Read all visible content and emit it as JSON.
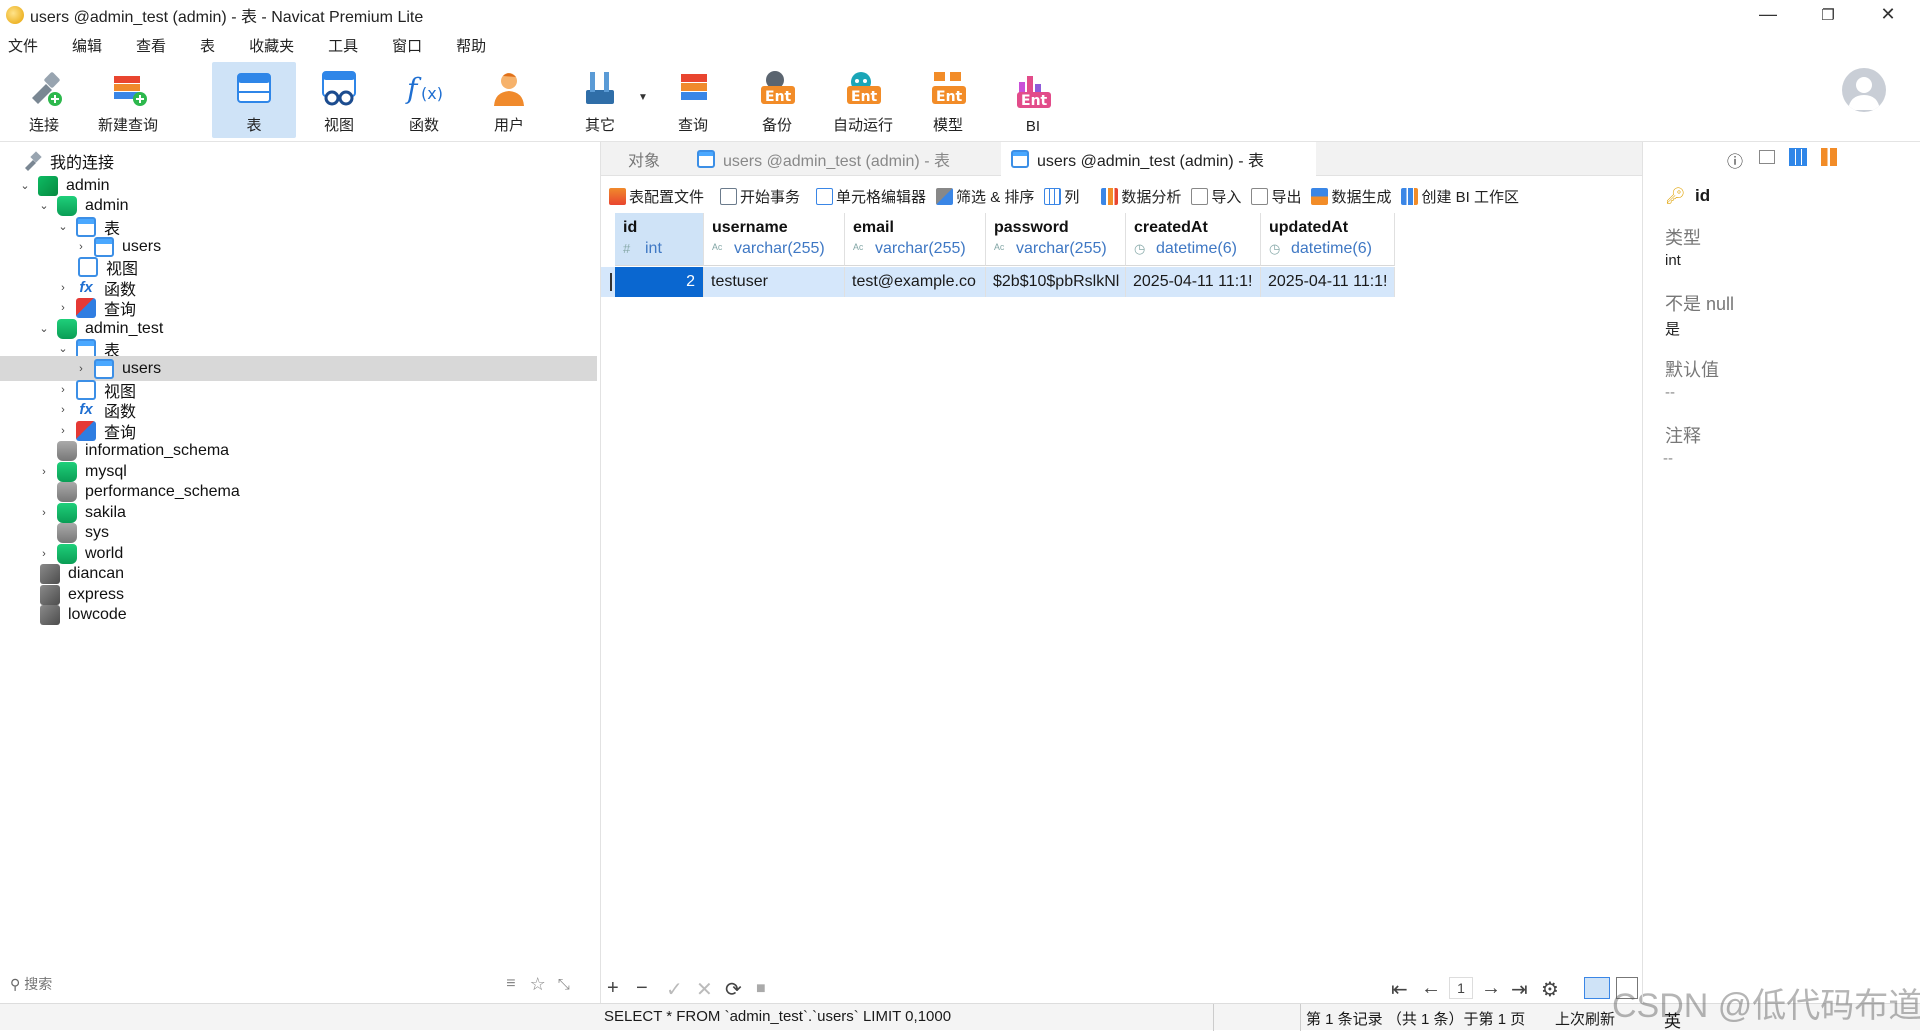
{
  "window": {
    "title": "users @admin_test (admin) - 表 - Navicat Premium Lite",
    "minimize": "—",
    "restore": "❐",
    "close": "✕"
  },
  "menu": [
    "文件",
    "编辑",
    "查看",
    "表",
    "收藏夹",
    "工具",
    "窗口",
    "帮助"
  ],
  "toolbar": {
    "connect": "连接",
    "new_query": "新建查询",
    "table": "表",
    "view": "视图",
    "function": "函数",
    "user": "用户",
    "other": "其它",
    "query": "查询",
    "backup": "备份",
    "automation": "自动运行",
    "model": "模型",
    "bi": "BI",
    "ent_badge": "Ent"
  },
  "tree": {
    "root": "我的连接",
    "conn_admin": "admin",
    "db_admin": "admin",
    "tables": "表",
    "users": "users",
    "views": "视图",
    "functions": "函数",
    "queries": "查询",
    "db_admin_test": "admin_test",
    "tables2": "表",
    "users2": "users",
    "views2": "视图",
    "functions2": "函数",
    "queries2": "查询",
    "db_information_schema": "information_schema",
    "db_mysql": "mysql",
    "db_performance_schema": "performance_schema",
    "db_sakila": "sakila",
    "db_sys": "sys",
    "db_world": "world",
    "conn_diancan": "diancan",
    "conn_express": "express",
    "conn_lowcode": "lowcode"
  },
  "left_search": {
    "placeholder": "搜索"
  },
  "tabs": {
    "objects": "对象",
    "tab1": "users @admin_test (admin) - 表",
    "tab2": "users @admin_test (admin) - 表"
  },
  "subtoolbar": {
    "table_profile": "表配置文件",
    "begin_transaction": "开始事务",
    "cell_editor": "单元格编辑器",
    "filter_sort": "筛选 & 排序",
    "columns": "列",
    "data_analysis": "数据分析",
    "import": "导入",
    "export": "导出",
    "data_generation": "数据生成",
    "create_bi": "创建 BI 工作区"
  },
  "grid": {
    "columns": [
      {
        "name": "id",
        "type": "int"
      },
      {
        "name": "username",
        "type": "varchar(255)"
      },
      {
        "name": "email",
        "type": "varchar(255)"
      },
      {
        "name": "password",
        "type": "varchar(255)"
      },
      {
        "name": "createdAt",
        "type": "datetime(6)"
      },
      {
        "name": "updatedAt",
        "type": "datetime(6)"
      }
    ],
    "rows": [
      [
        "2",
        "testuser",
        "test@example.co",
        "$2b$10$pbRslkNl",
        "2025-04-11 11:1!",
        "2025-04-11 11:1!"
      ]
    ]
  },
  "bottom": {
    "add": "+",
    "delete": "−",
    "apply": "✓",
    "discard": "✕",
    "refresh": "⟳",
    "stop": "■",
    "first": "⇤",
    "prev": "←",
    "page": "1",
    "next": "→",
    "last": "⇥",
    "settings": "⚙"
  },
  "status": {
    "sql": "SELECT * FROM `admin_test`.`users` LIMIT 0,1000",
    "record_info": "第 1 条记录 （共 1 条）于第 1 页",
    "last_refresh": "上次刷新",
    "watermark": "CSDN @低代码布道师",
    "ime": "英"
  },
  "right_panel": {
    "field_name": "id",
    "type_label": "类型",
    "type_value": "int",
    "notnull_label": "不是 null",
    "notnull_value": "是",
    "default_label": "默认值",
    "default_value": "--",
    "comment_label": "注释",
    "comment_value": "--"
  },
  "colors": {
    "accent": "#cfe3f7",
    "selected_cell": "#0a67d0",
    "row_highlight": "#d5e7fb",
    "type_text": "#3f78c4"
  }
}
